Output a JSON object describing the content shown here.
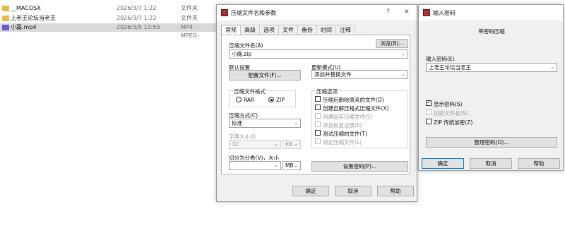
{
  "explorer": {
    "rows": [
      {
        "name": "__MACOSX",
        "date": "2026/3/7 1:22",
        "type": "文件夹"
      },
      {
        "name": "上老王论坛当老王",
        "date": "2026/3/7 1:22",
        "type": "文件夹"
      },
      {
        "name": "小磊.mp4",
        "date": "2026/3/5 10:59",
        "type": "MP4 - MPEG-"
      }
    ]
  },
  "archive_dialog": {
    "title": "压缩文件名和参数",
    "help": "?",
    "close": "✕",
    "tabs": [
      "常规",
      "高级",
      "选项",
      "文件",
      "备份",
      "时间",
      "注释"
    ],
    "archive_name_label": "压缩文件名(A)",
    "browse_button": "浏览(B)...",
    "archive_name_value": "小磊.zip",
    "default_profile_label": "默认设置",
    "profiles_button": "配置文件(F)...",
    "update_mode_label": "更新模式(U)",
    "update_mode_value": "添加并替换文件",
    "format_group_label": "压缩文件格式",
    "format_rar": "RAR",
    "format_zip": "ZIP",
    "method_label": "压缩方式(C)",
    "method_value": "标准",
    "dict_label": "字典大小(I)",
    "dict_value": "32",
    "dict_unit": "KB",
    "options_group_label": "压缩选项",
    "options": [
      {
        "label": "压缩后删除原来的文件(D)",
        "checked": false,
        "disabled": false
      },
      {
        "label": "创建自解压格式压缩文件(X)",
        "checked": false,
        "disabled": false
      },
      {
        "label": "创建固实压缩文件(S)",
        "checked": false,
        "disabled": true
      },
      {
        "label": "添加恢复记录(E)",
        "checked": false,
        "disabled": true
      },
      {
        "label": "测试压缩的文件(T)",
        "checked": false,
        "disabled": false
      },
      {
        "label": "锁定压缩文件(L)",
        "checked": false,
        "disabled": true
      }
    ],
    "split_label": "切分为分卷(V)，大小",
    "split_unit": "MB",
    "set_password_button": "设置密码(P)...",
    "ok_button": "确定",
    "cancel_button": "取消",
    "help_button": "帮助"
  },
  "password_dialog": {
    "title": "输入密码",
    "heading": "带密码压缩",
    "password_label": "输入密码(E)",
    "password_value": "上老王论坛当老王",
    "show_password": "显示密码(S)",
    "encrypt_names": "加密文件名(N)",
    "zip_legacy": "ZIP 传统加密(Z)",
    "organize_button": "整理密码(O)...",
    "ok_button": "确定",
    "cancel_button": "取消",
    "help_button": "帮助"
  }
}
